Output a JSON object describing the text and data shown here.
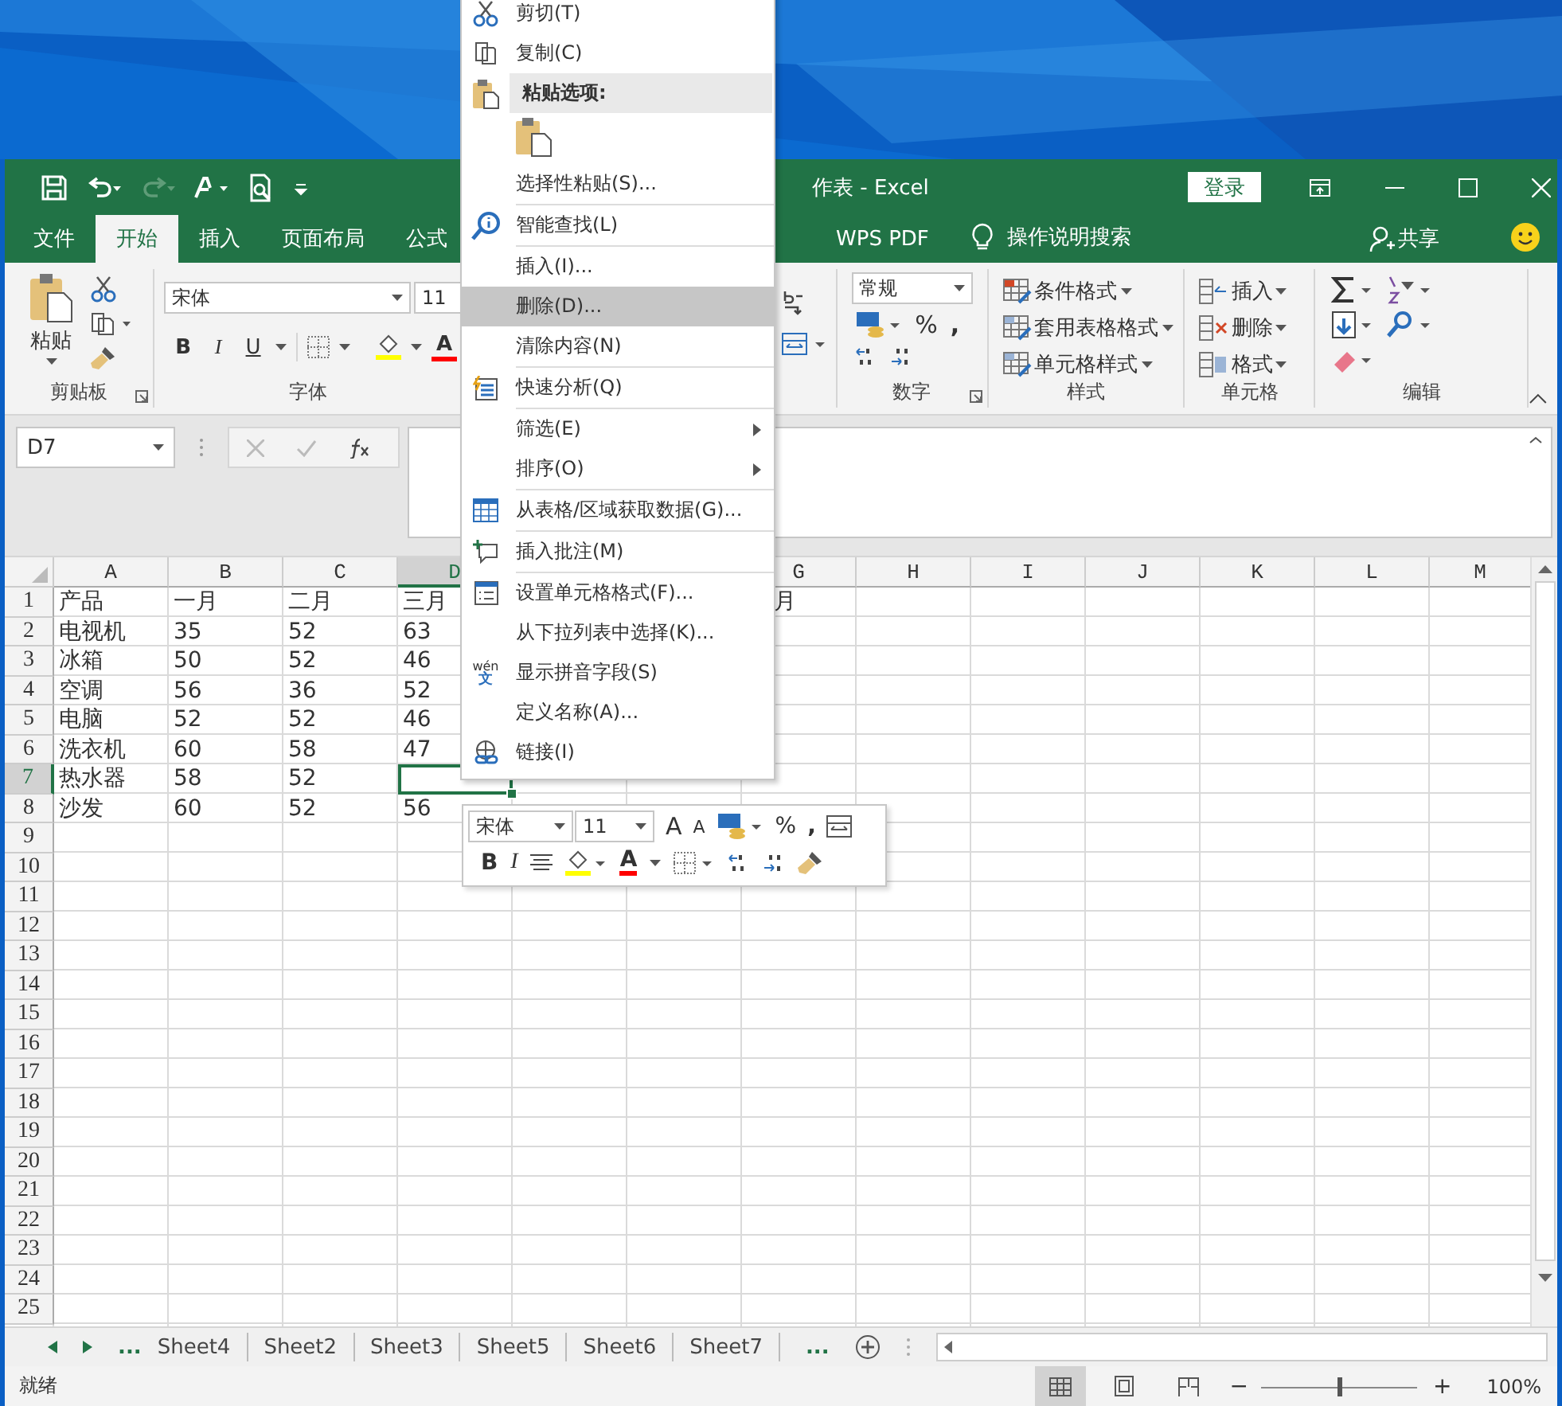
{
  "window": {
    "title": "作表 - Excel",
    "sign_in": "登录"
  },
  "tabs": [
    {
      "label": "文件",
      "selected": false
    },
    {
      "label": "开始",
      "selected": true
    },
    {
      "label": "插入",
      "selected": false
    },
    {
      "label": "页面布局",
      "selected": false
    },
    {
      "label": "公式",
      "selected": false
    },
    {
      "label": "WPS PDF",
      "selected": false
    }
  ],
  "tell_me": "操作说明搜索",
  "share": "共享",
  "ribbon": {
    "clipboard": {
      "paste": "粘贴",
      "label": "剪贴板"
    },
    "font": {
      "name": "宋体",
      "size": "11",
      "bold": "B",
      "italic": "I",
      "underline": "U",
      "font_color": "A",
      "label": "字体"
    },
    "number": {
      "format": "常规",
      "percent": "%",
      "comma": ",",
      "label": "数字"
    },
    "styles": {
      "items": [
        "条件格式",
        "套用表格格式",
        "单元格样式"
      ],
      "label": "样式"
    },
    "cells": {
      "items": [
        "插入",
        "删除",
        "格式"
      ],
      "label": "单元格"
    },
    "editing": {
      "label": "编辑"
    }
  },
  "name_box": "D7",
  "sheet": {
    "columns": [
      {
        "label": "A",
        "selected": false
      },
      {
        "label": "B",
        "selected": false
      },
      {
        "label": "C",
        "selected": false
      },
      {
        "label": "D",
        "selected": true
      },
      null,
      null,
      {
        "label": "G",
        "selected": false
      },
      {
        "label": "H",
        "selected": false
      },
      {
        "label": "I",
        "selected": false
      },
      {
        "label": "J",
        "selected": false
      },
      {
        "label": "K",
        "selected": false
      },
      {
        "label": "L",
        "selected": false
      },
      {
        "label": "M",
        "selected": false
      }
    ],
    "rows": [
      {
        "label": "1",
        "selected": false,
        "cells": [
          "产品",
          "一月",
          "二月",
          "三月",
          null,
          null,
          "月"
        ]
      },
      {
        "label": "2",
        "selected": false,
        "cells": [
          "电视机",
          "35",
          "52",
          "63"
        ]
      },
      {
        "label": "3",
        "selected": false,
        "cells": [
          "冰箱",
          "50",
          "52",
          "46"
        ]
      },
      {
        "label": "4",
        "selected": false,
        "cells": [
          "空调",
          "56",
          "36",
          "52"
        ]
      },
      {
        "label": "5",
        "selected": false,
        "cells": [
          "电脑",
          "52",
          "52",
          "46"
        ]
      },
      {
        "label": "6",
        "selected": false,
        "cells": [
          "洗衣机",
          "60",
          "58",
          "47"
        ]
      },
      {
        "label": "7",
        "selected": true,
        "cells": [
          "热水器",
          "58",
          "52"
        ]
      },
      {
        "label": "8",
        "selected": false,
        "cells": [
          "沙发",
          "60",
          "52",
          "56"
        ]
      },
      {
        "label": "9",
        "selected": false
      },
      {
        "label": "10",
        "selected": false
      },
      {
        "label": "11",
        "selected": false
      },
      {
        "label": "12",
        "selected": false
      },
      {
        "label": "13",
        "selected": false
      },
      {
        "label": "14",
        "selected": false
      },
      {
        "label": "15",
        "selected": false
      },
      {
        "label": "16",
        "selected": false
      },
      {
        "label": "17",
        "selected": false
      },
      {
        "label": "18",
        "selected": false
      },
      {
        "label": "19",
        "selected": false
      },
      {
        "label": "20",
        "selected": false
      },
      {
        "label": "21",
        "selected": false
      },
      {
        "label": "22",
        "selected": false
      },
      {
        "label": "23",
        "selected": false
      },
      {
        "label": "24",
        "selected": false
      },
      {
        "label": "25",
        "selected": false
      }
    ]
  },
  "context_menu": {
    "items": [
      {
        "kind": "item",
        "label": "剪切(T)",
        "selected": false
      },
      {
        "kind": "item",
        "label": "复制(C)",
        "selected": false
      },
      {
        "kind": "header",
        "label": "粘贴选项:"
      },
      {
        "kind": "paste_options"
      },
      {
        "kind": "item",
        "label": "选择性粘贴(S)...",
        "selected": false,
        "divider_below": true
      },
      {
        "kind": "item",
        "label": "智能查找(L)",
        "selected": false,
        "divider_below": true
      },
      {
        "kind": "item",
        "label": "插入(I)...",
        "selected": false
      },
      {
        "kind": "item",
        "label": "删除(D)...",
        "selected": true
      },
      {
        "kind": "item",
        "label": "清除内容(N)",
        "selected": false,
        "divider_below": true
      },
      {
        "kind": "item",
        "label": "快速分析(Q)",
        "selected": false,
        "divider_below": true
      },
      {
        "kind": "item",
        "label": "筛选(E)",
        "selected": false,
        "submenu": true
      },
      {
        "kind": "item",
        "label": "排序(O)",
        "selected": false,
        "submenu": true,
        "divider_below": true
      },
      {
        "kind": "item",
        "label": "从表格/区域获取数据(G)...",
        "selected": false,
        "divider_below": true
      },
      {
        "kind": "item",
        "label": "插入批注(M)",
        "selected": false,
        "divider_below": true
      },
      {
        "kind": "item",
        "label": "设置单元格格式(F)...",
        "selected": false
      },
      {
        "kind": "item",
        "label": "从下拉列表中选择(K)...",
        "selected": false
      },
      {
        "kind": "item",
        "label": "显示拼音字段(S)",
        "selected": false,
        "badge_top": "wén",
        "badge_bottom": "文"
      },
      {
        "kind": "item",
        "label": "定义名称(A)...",
        "selected": false
      },
      {
        "kind": "item",
        "label": "链接(I)",
        "selected": false
      }
    ]
  },
  "mini_toolbar": {
    "font": "宋体",
    "size": "11",
    "grow_font": "A",
    "shrink_font": "A",
    "percent": "%",
    "comma": ",",
    "bold": "B",
    "italic": "I",
    "font_color": "A"
  },
  "sheet_tabs": {
    "more_left": "...",
    "tabs": [
      "Sheet4",
      "Sheet2",
      "Sheet3",
      "Sheet5",
      "Sheet6",
      "Sheet7"
    ],
    "more_right": "..."
  },
  "status_bar": {
    "text": "就绪",
    "zoom_out": "−",
    "zoom_in": "+",
    "zoom": "100%",
    "zoom_slider": {
      "level": 0.5
    }
  }
}
